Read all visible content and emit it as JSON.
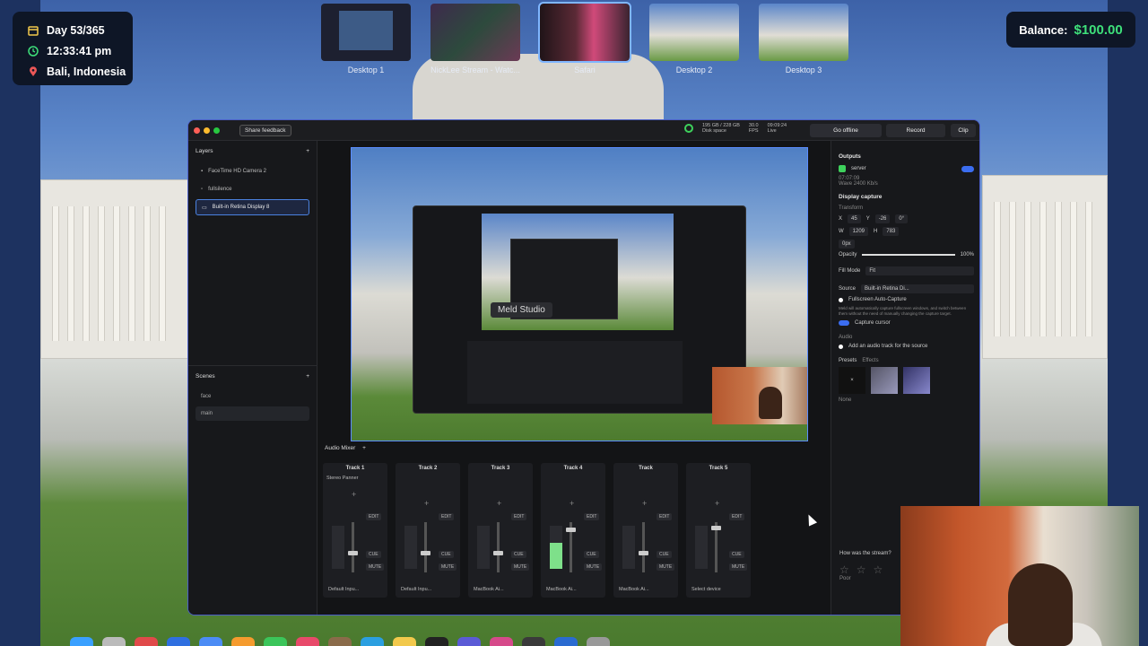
{
  "hud": {
    "day": "Day 53/365",
    "time": "12:33:41 pm",
    "location": "Bali, Indonesia",
    "balance_label": "Balance:",
    "balance_value": "$100.00",
    "icon_colors": {
      "calendar": "#f2c94c",
      "clock": "#3ee07a",
      "pin": "#eb5757"
    }
  },
  "spaces": [
    {
      "label": "Desktop 1",
      "active": false
    },
    {
      "label": "NickLee Stream - Watc...",
      "active": false
    },
    {
      "label": "Safari",
      "active": true
    },
    {
      "label": "Desktop 2",
      "active": false
    },
    {
      "label": "Desktop 3",
      "active": false
    }
  ],
  "app": {
    "feedback_button": "Share feedback",
    "disk": "195 GB / 228 GB",
    "disk_label": "Disk space",
    "fps": "30.0",
    "fps_label": "FPS",
    "live_time": "09:09:24",
    "live_label": "Live",
    "go_offline": "Go offline",
    "record": "Record",
    "clip": "Clip"
  },
  "layers": {
    "title": "Layers",
    "items": [
      {
        "label": "FaceTime HD Camera 2",
        "selected": false
      },
      {
        "label": "fullsilence",
        "selected": false
      },
      {
        "label": "Built-in Retina Display 8",
        "selected": true
      }
    ]
  },
  "scenes": {
    "title": "Scenes",
    "items": [
      {
        "label": "face",
        "selected": false
      },
      {
        "label": "main",
        "selected": true
      }
    ]
  },
  "preview": {
    "watermark": "Meld Studio"
  },
  "mixer": {
    "title": "Audio Mixer",
    "tracks": [
      {
        "name": "Track 1",
        "device": "Default Inpu...",
        "effect": "Stereo Panner"
      },
      {
        "name": "Track 2",
        "device": "Default Inpu...",
        "effect": ""
      },
      {
        "name": "Track 3",
        "device": "MacBook Ai...",
        "effect": ""
      },
      {
        "name": "Track 4",
        "device": "MacBook Ai...",
        "effect": ""
      },
      {
        "name": "Track",
        "device": "MacBook Ai...",
        "effect": ""
      },
      {
        "name": "Track 5",
        "device": "Select device",
        "effect": ""
      }
    ],
    "edit": "EDIT",
    "cue": "CUE",
    "mute": "MUTE"
  },
  "right_panel": {
    "outputs_title": "Outputs",
    "server": "server",
    "server_sub": "07:07:09",
    "bitrate": "Wave 2400 Kb/s",
    "display_capture": "Display capture",
    "transform": "Transform",
    "x": "45",
    "y": "-26",
    "rot": "0°",
    "w": "1209",
    "h": "783",
    "radius": "0px",
    "opacity_label": "Opacity",
    "opacity": "100%",
    "fill_mode_label": "Fill Mode",
    "fill_mode": "Fit",
    "source_label": "Source",
    "source": "Built-in Retina Di...",
    "fullscreen": "Fullscreen Auto-Capture",
    "fullscreen_desc": "Meld will automatically capture fullscreen windows, and switch between them without the need of manually changing the capture target.",
    "capture_cursor": "Capture cursor",
    "audio_label": "Audio",
    "audio_add": "Add an audio track for the source",
    "presets": "Presets",
    "effects": "Effects",
    "preset_none": "None",
    "rate_title": "How was the stream?",
    "rate_poor": "Poor"
  }
}
